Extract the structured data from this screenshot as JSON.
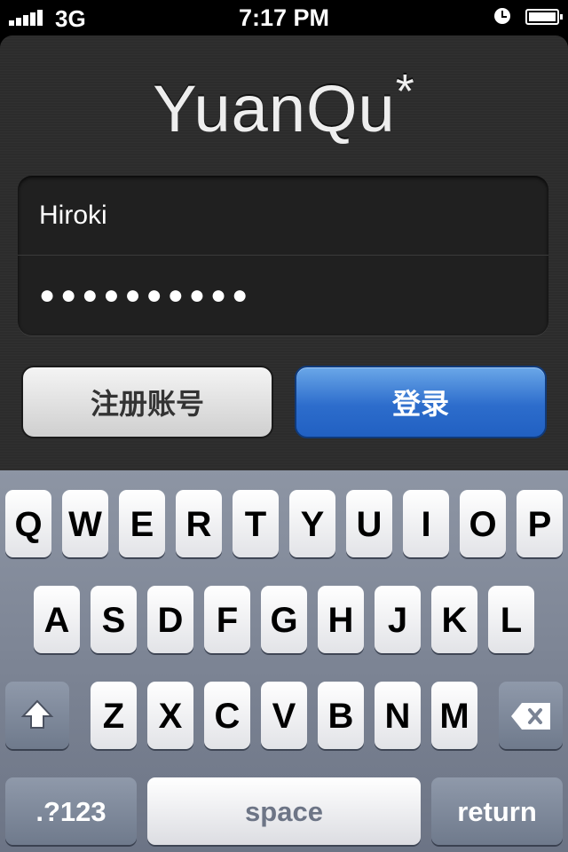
{
  "status_bar": {
    "carrier": "3G",
    "time": "7:17 PM"
  },
  "app": {
    "logo": "YuanQu",
    "logo_mark": "*",
    "username_value": "Hiroki",
    "password_value": "●●●●●●●●●●",
    "register_button": "注册账号",
    "login_button": "登录",
    "accent_blue": "#2d6dcc"
  },
  "keyboard": {
    "row1": [
      "Q",
      "W",
      "E",
      "R",
      "T",
      "Y",
      "U",
      "I",
      "O",
      "P"
    ],
    "row2": [
      "A",
      "S",
      "D",
      "F",
      "G",
      "H",
      "J",
      "K",
      "L"
    ],
    "row3": [
      "Z",
      "X",
      "C",
      "V",
      "B",
      "N",
      "M"
    ],
    "shift_icon": "shift-arrow-icon",
    "delete_icon": "backspace-icon",
    "numbers_label": ".?123",
    "space_label": "space",
    "return_label": "return"
  }
}
